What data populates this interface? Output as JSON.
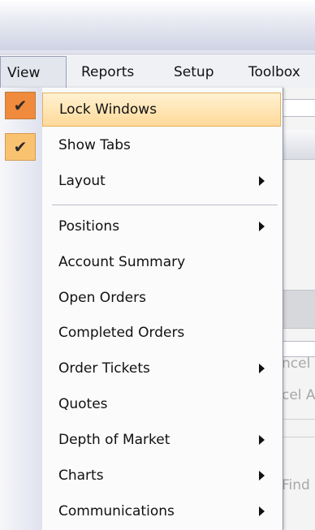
{
  "menubar": {
    "items": [
      {
        "label": "View"
      },
      {
        "label": "Reports"
      },
      {
        "label": "Setup"
      },
      {
        "label": "Toolbox"
      }
    ]
  },
  "background": {
    "cancel_partial": "ncel",
    "cancel_all_partial": "cel A",
    "find_partial": "Find"
  },
  "view_menu": {
    "items": [
      {
        "label": "Lock Windows",
        "checked": true,
        "highlighted": true,
        "submenu": false
      },
      {
        "label": "Show Tabs",
        "checked": true,
        "highlighted": false,
        "submenu": false
      },
      {
        "label": "Layout",
        "checked": false,
        "submenu": true
      },
      {
        "label": "Positions",
        "checked": false,
        "submenu": true
      },
      {
        "label": "Account Summary",
        "checked": false,
        "submenu": false
      },
      {
        "label": "Open Orders",
        "checked": false,
        "submenu": false
      },
      {
        "label": "Completed Orders",
        "checked": false,
        "submenu": false
      },
      {
        "label": "Order Tickets",
        "checked": false,
        "submenu": true
      },
      {
        "label": "Quotes",
        "checked": false,
        "submenu": false
      },
      {
        "label": "Depth of Market",
        "checked": false,
        "submenu": true
      },
      {
        "label": "Charts",
        "checked": false,
        "submenu": true
      },
      {
        "label": "Communications",
        "checked": false,
        "submenu": true
      }
    ],
    "check_glyph": "✔"
  },
  "colors": {
    "highlight_border": "#e6b05d",
    "check_active": "#f08a3c",
    "check_inactive": "#f9c270"
  }
}
